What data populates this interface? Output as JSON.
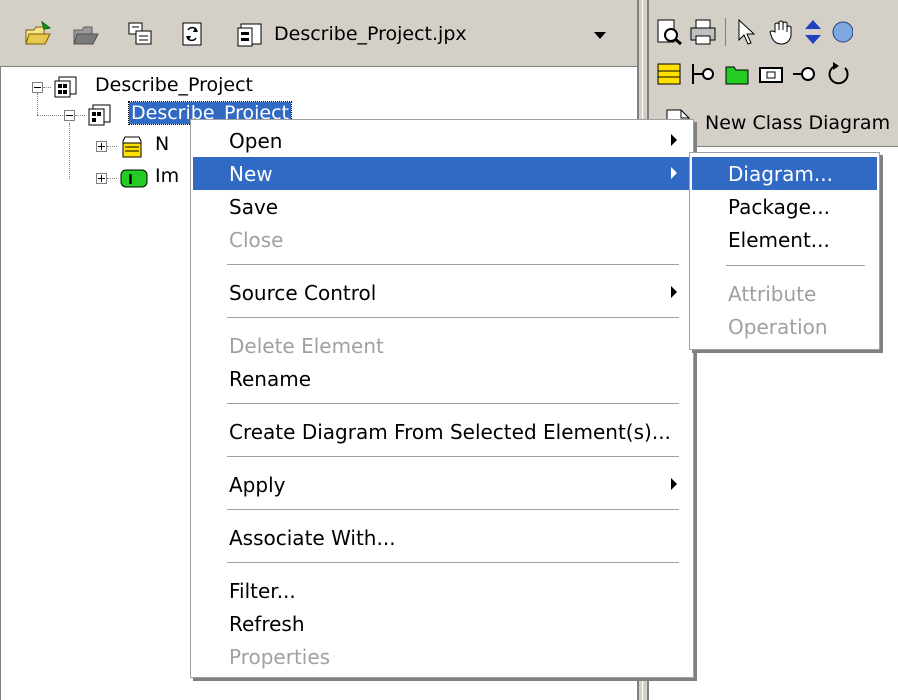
{
  "toolbar": {
    "project_file": "Describe_Project.jpx",
    "icons": [
      "open-project-icon",
      "close-project-icon",
      "properties-icon",
      "refresh-icon",
      "project-file-icon"
    ]
  },
  "tree": {
    "root_label": "Describe_Project",
    "child_label": "Describe_Project",
    "partial_items": [
      "N",
      "Im"
    ]
  },
  "diagram_tab": {
    "label": "New Class Diagram"
  },
  "context_menu": {
    "items": [
      {
        "label": "Open",
        "submenu": true,
        "disabled": false
      },
      {
        "label": "New",
        "submenu": true,
        "disabled": false,
        "highlighted": true
      },
      {
        "label": "Save",
        "submenu": false,
        "disabled": false
      },
      {
        "label": "Close",
        "submenu": false,
        "disabled": true
      },
      {
        "label": "Source Control",
        "submenu": true,
        "disabled": false
      },
      {
        "label": "Delete Element",
        "submenu": false,
        "disabled": true
      },
      {
        "label": "Rename",
        "submenu": false,
        "disabled": false
      },
      {
        "label": "Create Diagram From Selected Element(s)...",
        "submenu": false,
        "disabled": false
      },
      {
        "label": "Apply",
        "submenu": true,
        "disabled": false
      },
      {
        "label": "Associate With...",
        "submenu": false,
        "disabled": false
      },
      {
        "label": "Filter...",
        "submenu": false,
        "disabled": false
      },
      {
        "label": "Refresh",
        "submenu": false,
        "disabled": false
      },
      {
        "label": "Properties",
        "submenu": false,
        "disabled": true
      }
    ]
  },
  "submenu": {
    "items": [
      {
        "label": "Diagram...",
        "disabled": false,
        "highlighted": true
      },
      {
        "label": "Package...",
        "disabled": false
      },
      {
        "label": "Element...",
        "disabled": false
      },
      {
        "label": "Attribute",
        "disabled": true
      },
      {
        "label": "Operation",
        "disabled": true
      }
    ]
  },
  "colors": {
    "highlight": "#316ac5",
    "chrome": "#d4d0c8",
    "disabled_text": "#a0a0a0"
  }
}
